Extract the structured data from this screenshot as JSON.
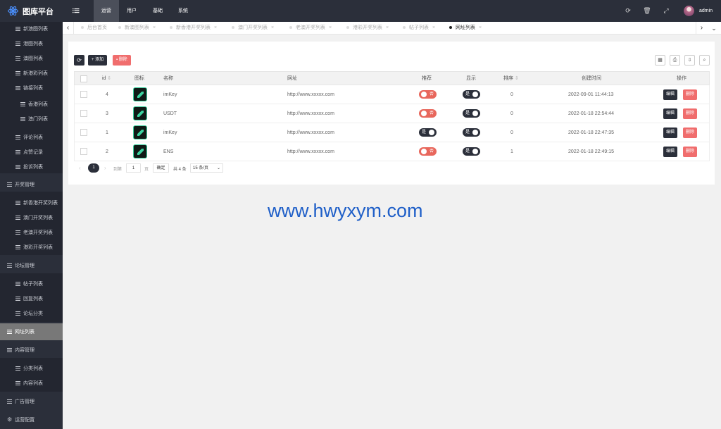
{
  "app": {
    "title": "图库平台"
  },
  "topnav": {
    "items": [
      "运营",
      "用户",
      "基础",
      "系统"
    ],
    "user": "admin"
  },
  "sidebar": {
    "items": [
      "新澳图列表",
      "港图列表",
      "澳图列表",
      "新港彩列表",
      "链接列表",
      "香港列表",
      "澳门列表",
      "评论列表",
      "点赞记录",
      "投诉列表",
      "开奖管理",
      "新香港开奖列表",
      "澳门开奖列表",
      "老澳开奖列表",
      "港彩开奖列表",
      "论坛管理",
      "帖子列表",
      "回复列表",
      "论坛分类",
      "网址列表",
      "内容管理",
      "分类列表",
      "内容列表",
      "广告管理",
      "运营配置"
    ]
  },
  "tabs": {
    "items": [
      "后台首页",
      "新澳图列表",
      "新香港开奖列表",
      "澳门开奖列表",
      "老澳开奖列表",
      "港彩开奖列表",
      "帖子列表",
      "网址列表"
    ]
  },
  "toolbar": {
    "refresh": "⟳",
    "add": "+ 添加",
    "delete": "删除"
  },
  "table": {
    "headers": [
      "id",
      "图标",
      "名称",
      "网址",
      "推荐",
      "显示",
      "排序",
      "创建时间",
      "操作"
    ],
    "rows": [
      {
        "id": "4",
        "name": "imKey",
        "url": "http://www.xxxxx.com",
        "recommend": "否",
        "display": "是",
        "sort": "0",
        "created": "2022-09-01 11:44:13"
      },
      {
        "id": "3",
        "name": "USDT",
        "url": "http://www.xxxxx.com",
        "recommend": "否",
        "display": "是",
        "sort": "0",
        "created": "2022-01-18 22:54:44"
      },
      {
        "id": "1",
        "name": "imKey",
        "url": "http://www.xxxxx.com",
        "recommend": "是",
        "display": "是",
        "sort": "0",
        "created": "2022-01-18 22:47:35"
      },
      {
        "id": "2",
        "name": "ENS",
        "url": "http://www.xxxxx.com",
        "recommend": "否",
        "display": "是",
        "sort": "1",
        "created": "2022-01-18 22:49:15"
      }
    ],
    "edit_label": "编辑",
    "delete_label": "删除"
  },
  "pager": {
    "current": "1",
    "goto_prefix": "到第",
    "goto_value": "1",
    "goto_suffix": "页",
    "confirm": "确定",
    "total": "共 4 条",
    "per_page": "15 条/页"
  },
  "watermark": "www.hwyxym.com",
  "colors": {
    "sidebar": "#2b2f3a",
    "active_item": "#787878",
    "danger": "#f06d6d",
    "watermark": "#1f5fc8"
  }
}
